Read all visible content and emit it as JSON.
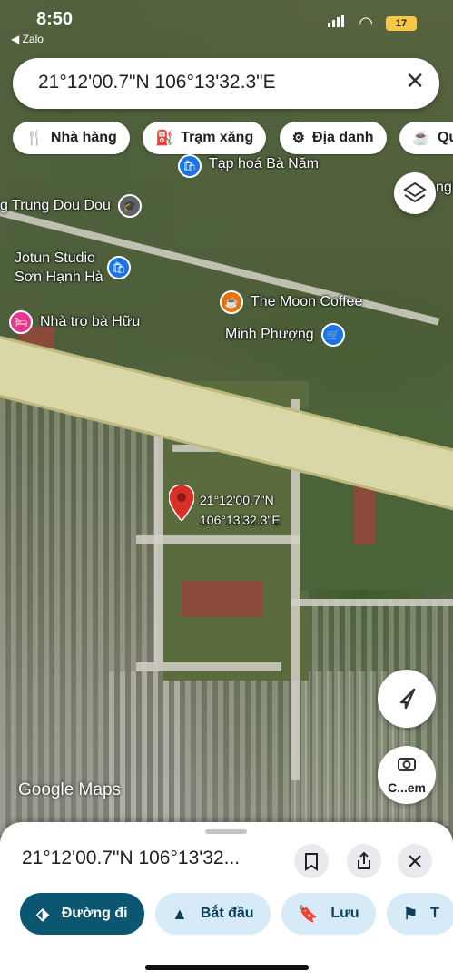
{
  "status": {
    "time": "8:50",
    "back_app": "◀ Zalo",
    "battery": "17"
  },
  "search": {
    "value": "21°12'00.7\"N 106°13'32.3\"E"
  },
  "chips": [
    {
      "icon": "fork-knife-icon",
      "label": "Nhà hàng"
    },
    {
      "icon": "gas-pump-icon",
      "label": "Trạm xăng"
    },
    {
      "icon": "landmark-icon",
      "label": "Địa danh"
    },
    {
      "icon": "coffee-cup-icon",
      "label": "Qu"
    }
  ],
  "pois": {
    "taphoa": "Tạp hoá Bà Năm",
    "trung": "g Trung Dou Dou",
    "jotun1": "Jotun Studio",
    "jotun2": "Sơn Hạnh Hà",
    "nhatro": "Nhà trọ bà Hữu",
    "moon": "The Moon Coffee",
    "minh": "Minh Phượng",
    "nghi": "nghi"
  },
  "pin_label": {
    "line1": "21°12'00.7\"N",
    "line2": "106°13'32.3\"E"
  },
  "camera_label": "C...em",
  "google": "Google Maps",
  "sheet": {
    "title": "21°12'00.7\"N 106°13'32...",
    "actions": [
      {
        "icon": "directions-icon",
        "label": "Đường đi"
      },
      {
        "icon": "navigation-arrow-icon",
        "label": "Bắt đầu"
      },
      {
        "icon": "bookmark-icon",
        "label": "Lưu"
      },
      {
        "icon": "flag-icon",
        "label": "T"
      }
    ]
  },
  "colors": {
    "primary": "#0b5772",
    "secondary": "#d6ebf7",
    "pin": "#d93025"
  }
}
